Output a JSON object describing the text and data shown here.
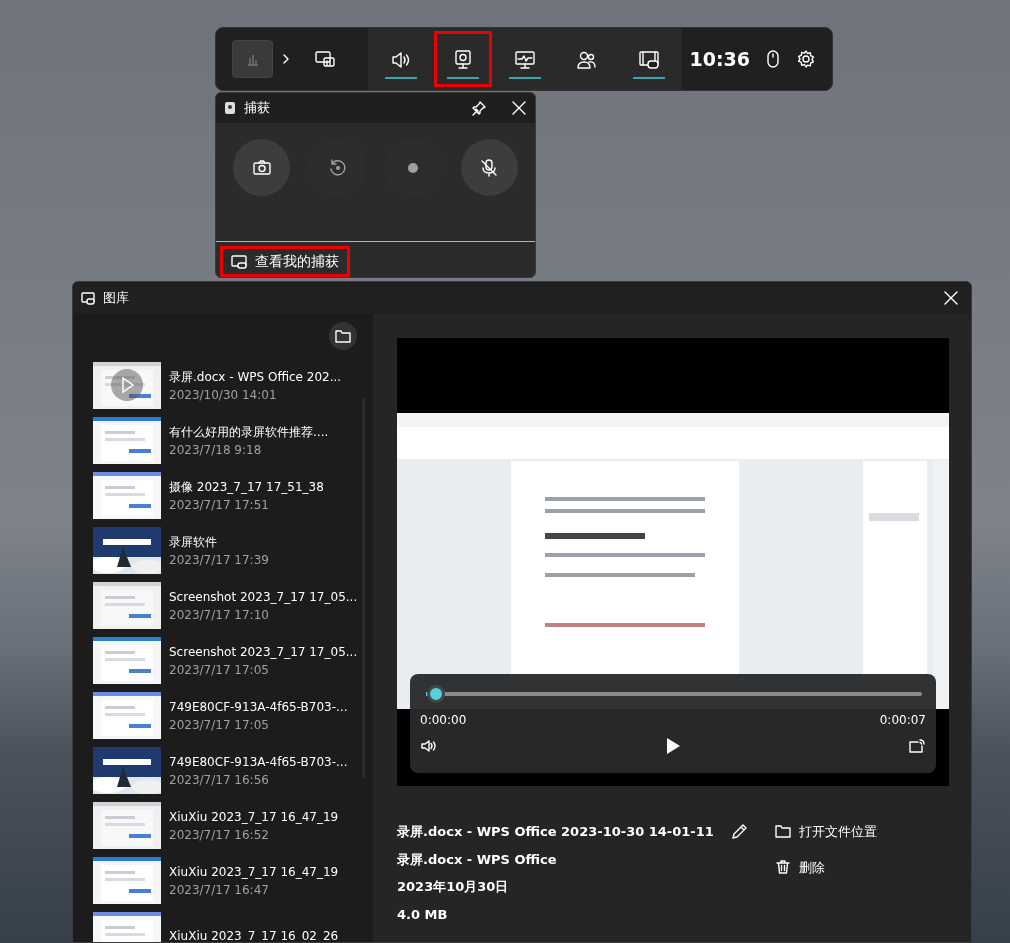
{
  "toolbar": {
    "widgets": [
      {
        "kind": "display",
        "active": false,
        "highlighted": false
      },
      {
        "kind": "audio",
        "active": true,
        "highlighted": false
      },
      {
        "kind": "capture",
        "active": true,
        "highlighted": true
      },
      {
        "kind": "performance",
        "active": true,
        "highlighted": false
      },
      {
        "kind": "social",
        "active": false,
        "highlighted": false
      },
      {
        "kind": "gallery",
        "active": true,
        "highlighted": false
      }
    ],
    "time": "10:36"
  },
  "capture_panel": {
    "title": "捕获",
    "buttons": [
      {
        "kind": "screenshot",
        "disabled": false
      },
      {
        "kind": "record-last",
        "disabled": true
      },
      {
        "kind": "record",
        "disabled": true
      },
      {
        "kind": "mic-off",
        "disabled": false
      }
    ],
    "view_link": {
      "label": "查看我的捕获",
      "highlighted": true
    }
  },
  "gallery": {
    "title": "图库",
    "items": [
      {
        "title": "录屏.docx - WPS Office 202...",
        "date": "2023/10/30 14:01",
        "play_overlay": true
      },
      {
        "title": "有什么好用的录屏软件推荐....",
        "date": "2023/7/18 9:18",
        "play_overlay": false
      },
      {
        "title": "摄像 2023_7_17 17_51_38",
        "date": "2023/7/17 17:51",
        "play_overlay": false
      },
      {
        "title": "录屏软件",
        "date": "2023/7/17 17:39",
        "play_overlay": false
      },
      {
        "title": "Screenshot 2023_7_17 17_05...",
        "date": "2023/7/17 17:10",
        "play_overlay": false
      },
      {
        "title": "Screenshot 2023_7_17 17_05...",
        "date": "2023/7/17 17:05",
        "play_overlay": false
      },
      {
        "title": "749E80CF-913A-4f65-B703-...",
        "date": "2023/7/17 17:05",
        "play_overlay": false
      },
      {
        "title": "749E80CF-913A-4f65-B703-...",
        "date": "2023/7/17 16:56",
        "play_overlay": false
      },
      {
        "title": "XiuXiu 2023_7_17 16_47_19",
        "date": "2023/7/17 16:52",
        "play_overlay": false
      },
      {
        "title": "XiuXiu 2023_7_17 16_47_19",
        "date": "2023/7/17 16:47",
        "play_overlay": false
      },
      {
        "title": "XiuXiu 2023_7_17 16_02_26",
        "play_overlay": false
      }
    ],
    "player": {
      "level": 0.02,
      "current_time": "0:00:00",
      "total_time": "0:00:07"
    },
    "details": {
      "file_name": "录屏.docx - WPS Office 2023-10-30 14-01-11",
      "app": "录屏.docx - WPS Office",
      "date": "2023年10月30日",
      "size": "4.0 MB"
    },
    "actions": [
      {
        "kind": "open-folder",
        "label": "打开文件位置"
      },
      {
        "kind": "delete",
        "label": "删除"
      }
    ]
  }
}
